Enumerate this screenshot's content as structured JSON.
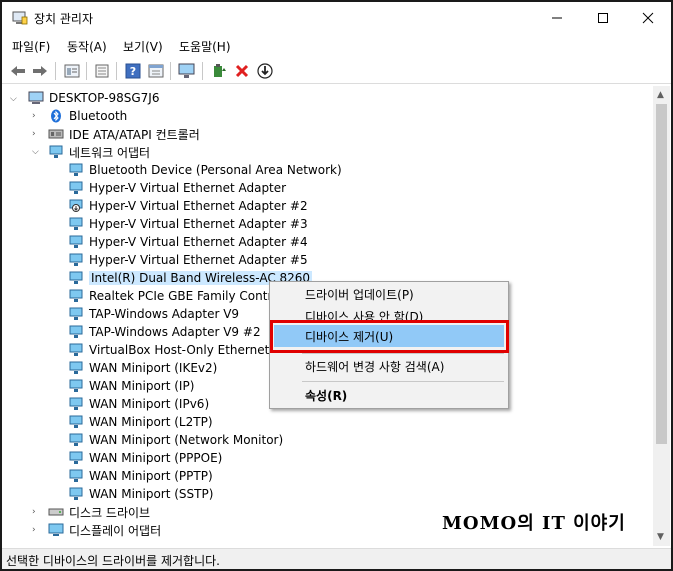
{
  "window": {
    "title": "장치 관리자"
  },
  "menubar": {
    "items": [
      "파일(F)",
      "동작(A)",
      "보기(V)",
      "도움말(H)"
    ]
  },
  "toolbar": {
    "buttons": [
      "back-icon",
      "forward-icon",
      "properties-icon",
      "details-icon",
      "help-icon",
      "view-icon",
      "monitor-icon",
      "update-driver-icon",
      "uninstall-icon",
      "download-icon"
    ]
  },
  "tree": {
    "root": "DESKTOP-98SG7J6",
    "categories": [
      {
        "label": "Bluetooth",
        "expanded": false
      },
      {
        "label": "IDE ATA/ATAPI 컨트롤러",
        "expanded": false
      },
      {
        "label": "네트워크 어댑터",
        "expanded": true
      }
    ],
    "network_adapters": [
      "Bluetooth Device (Personal Area Network)",
      "Hyper-V Virtual Ethernet Adapter",
      "Hyper-V Virtual Ethernet Adapter #2",
      "Hyper-V Virtual Ethernet Adapter #3",
      "Hyper-V Virtual Ethernet Adapter #4",
      "Hyper-V Virtual Ethernet Adapter #5",
      "Intel(R) Dual Band Wireless-AC 8260",
      "Realtek PCIe GBE Family Controlle",
      "TAP-Windows Adapter V9",
      "TAP-Windows Adapter V9 #2",
      "VirtualBox Host-Only Ethernet Ad",
      "WAN Miniport (IKEv2)",
      "WAN Miniport (IP)",
      "WAN Miniport (IPv6)",
      "WAN Miniport (L2TP)",
      "WAN Miniport (Network Monitor)",
      "WAN Miniport (PPPOE)",
      "WAN Miniport (PPTP)",
      "WAN Miniport (SSTP)"
    ],
    "after_categories": [
      {
        "label": "디스크 드라이브"
      },
      {
        "label": "디스플레이 어댑터"
      }
    ],
    "selected": "Intel(R) Dual Band Wireless-AC 8260"
  },
  "context_menu": {
    "items": [
      {
        "label": "드라이버 업데이트(P)"
      },
      {
        "label": "디바이스 사용 안 함(D)"
      },
      {
        "label": "디바이스 제거(U)"
      },
      {
        "label": "하드웨어 변경 사항 검색(A)"
      },
      {
        "label": "속성(R)"
      }
    ],
    "highlighted": "디바이스 제거(U)"
  },
  "statusbar": {
    "text": "선택한 디바이스의 드라이버를 제거합니다."
  },
  "watermark": {
    "text": "MOMO의 IT 이야기"
  },
  "colors": {
    "selection": "#cce8ff",
    "menu_highlight": "#91c9f7",
    "annotation_red": "#e00000"
  }
}
